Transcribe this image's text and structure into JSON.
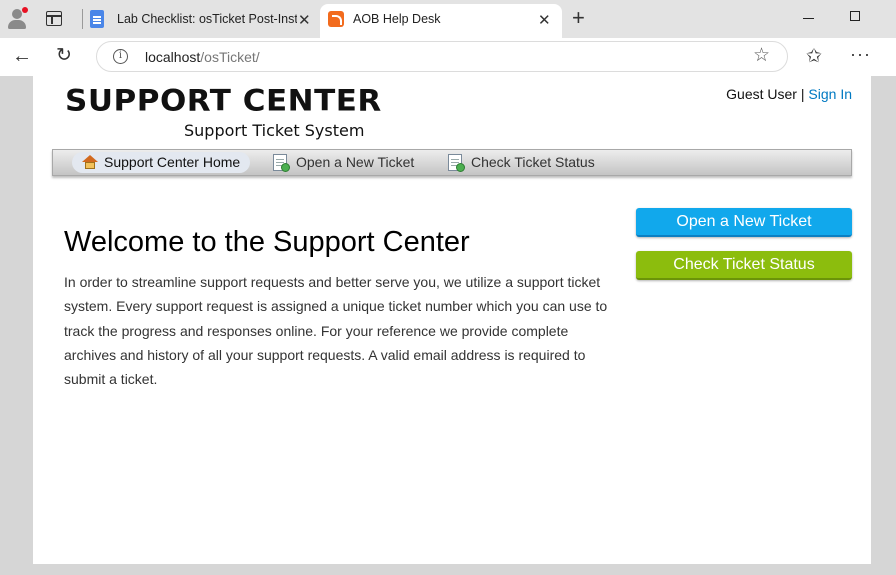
{
  "browser": {
    "tabs": [
      {
        "title": "Lab Checklist: osTicket Post-Install",
        "active": false
      },
      {
        "title": "AOB Help Desk",
        "active": true
      }
    ],
    "address": {
      "host": "localhost",
      "path": "/osTicket/"
    },
    "icons": {
      "profile": "profile-icon",
      "tab_actions": "tab-actions-icon",
      "back": "back-arrow-icon",
      "reload": "reload-icon",
      "info": "site-info-icon",
      "favorite": "star-icon",
      "favorites_bar": "favorites-icon",
      "more": "more-icon"
    }
  },
  "site": {
    "logo_title": "SUPPORT CENTER",
    "logo_subtitle": "Support Ticket System",
    "user_label": "Guest User",
    "separator": "|",
    "sign_in": "Sign In"
  },
  "nav": {
    "items": [
      {
        "label": "Support Center Home",
        "icon": "home-icon",
        "active": true
      },
      {
        "label": "Open a New Ticket",
        "icon": "new-ticket-icon",
        "active": false
      },
      {
        "label": "Check Ticket Status",
        "icon": "ticket-status-icon",
        "active": false
      }
    ]
  },
  "main": {
    "title": "Welcome to the Support Center",
    "body": "In order to streamline support requests and better serve you, we utilize a support ticket system. Every support request is assigned a unique ticket number which you can use to track the progress and responses online. For your reference we provide complete archives and history of all your support requests. A valid email address is required to submit a ticket."
  },
  "sidebar": {
    "open_ticket": "Open a New Ticket",
    "check_status": "Check Ticket Status"
  },
  "colors": {
    "link": "#0079c2",
    "open_button": "#11a8ec",
    "check_button": "#8cbd0d",
    "page_background": "#d6d6d6"
  }
}
